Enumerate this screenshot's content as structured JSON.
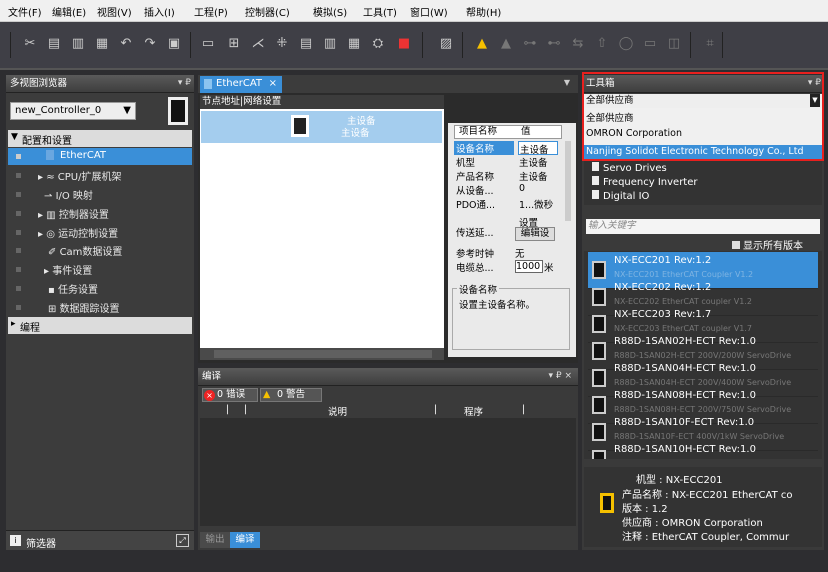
{
  "menu": [
    "文件(F)",
    "编辑(E)",
    "视图(V)",
    "插入(I)",
    "工程(P)",
    "控制器(C)",
    "模拟(S)",
    "工具(T)",
    "窗口(W)",
    "帮助(H)"
  ],
  "explorer": {
    "title": "多视图浏览器",
    "pin": "▾ ₽",
    "controller": "new_Controller_0",
    "config_header": "配置和设置",
    "items": [
      "EtherCAT",
      "CPU/扩展机架",
      "I/O 映射",
      "控制器设置",
      "运动控制设置",
      "Cam数据设置",
      "事件设置",
      "任务设置",
      "数据跟踪设置"
    ],
    "programming": "编程",
    "filter": "筛选器"
  },
  "editor": {
    "tab": "EtherCAT",
    "tab_close": "×",
    "node_header": "节点地址|网络设置",
    "master_line1": "主设备",
    "master_line2": "主设备",
    "prop_head_name": "项目名称",
    "prop_head_value": "值",
    "props": [
      {
        "name": "设备名称",
        "value": "主设备"
      },
      {
        "name": "机型",
        "value": "主设备"
      },
      {
        "name": "产品名称",
        "value": "主设备"
      },
      {
        "name": "从设备...",
        "value": "0"
      },
      {
        "name": "PDO通...",
        "value": "1...微秒"
      }
    ],
    "transfer_label": "传送延...",
    "transfer_value": "设置",
    "edit_btn": "编辑设",
    "ref_clock_label": "参考时钟",
    "ref_clock_value": "无",
    "cable_label": "电缆总...",
    "cable_value": "1000",
    "cable_unit": "米",
    "desc_title": "设备名称",
    "desc_text": "设置主设备名称。"
  },
  "compile": {
    "title": "编译",
    "pin": "▾ ₽ ×",
    "errors": "0 错误",
    "warnings": "0 警告",
    "col_desc": "说明",
    "col_prog": "程序",
    "tab_output": "输出",
    "tab_compile": "编译"
  },
  "toolbox": {
    "title": "工具箱",
    "vendor_selected": "全部供应商",
    "vendors": [
      "全部供应商",
      "OMRON Corporation",
      "Nanjing Solidot Electronic Technology Co., Ltd"
    ],
    "categories": [
      "Servo Drives",
      "Frequency Inverter",
      "Digital IO"
    ],
    "search_placeholder": "输入关键字",
    "show_all": "显示所有版本",
    "items": [
      {
        "name": "NX-ECC201 Rev:1.2",
        "desc": "NX-ECC201 EtherCAT Coupler V1.2"
      },
      {
        "name": "NX-ECC202 Rev:1.2",
        "desc": "NX-ECC202 EtherCAT coupler V1.2"
      },
      {
        "name": "NX-ECC203 Rev:1.7",
        "desc": "NX-ECC203 EtherCAT coupler V1.7"
      },
      {
        "name": "R88D-1SAN02H-ECT Rev:1.0",
        "desc": "R88D-1SAN02H-ECT 200V/200W ServoDrive"
      },
      {
        "name": "R88D-1SAN04H-ECT Rev:1.0",
        "desc": "R88D-1SAN04H-ECT 200V/400W ServoDrive"
      },
      {
        "name": "R88D-1SAN08H-ECT Rev:1.0",
        "desc": "R88D-1SAN08H-ECT 200V/750W ServoDrive"
      },
      {
        "name": "R88D-1SAN10F-ECT Rev:1.0",
        "desc": "R88D-1SAN10F-ECT 400V/1kW ServoDrive"
      },
      {
        "name": "R88D-1SAN10H-ECT Rev:1.0",
        "desc": ""
      }
    ],
    "info_model": "机型 : NX-ECC201",
    "info_product": "产品名称 : NX-ECC201 EtherCAT co",
    "info_version": "版本 : 1.2",
    "info_vendor": "供应商 : OMRON Corporation",
    "info_note": "注释 : EtherCAT Coupler, Commur"
  },
  "colors": {
    "accent": "#3399ff",
    "highlight_border": "#e8201e",
    "selected_item": "#3a8fd8"
  }
}
